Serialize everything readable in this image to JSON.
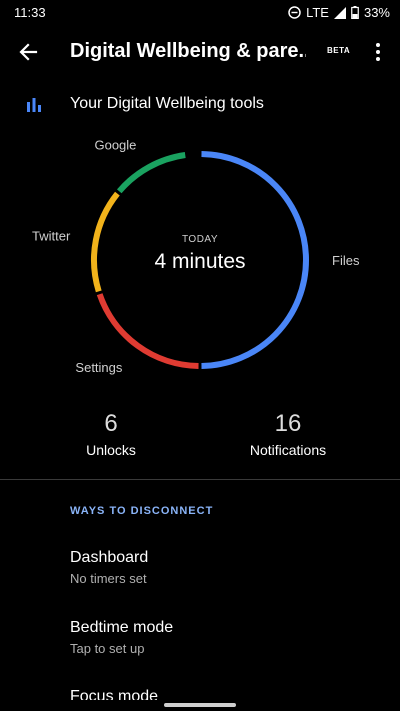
{
  "status_bar": {
    "time": "11:33",
    "network": "LTE",
    "battery": "33%"
  },
  "app_bar": {
    "title": "Digital Wellbeing & pare...",
    "badge": "BETA"
  },
  "header": {
    "title": "Your Digital Wellbeing tools"
  },
  "colors": {
    "accent_blue": "#4a86f7",
    "red": "#df3b32",
    "yellow": "#f2b31b",
    "green": "#1aa260",
    "section_label": "#8ab4f8"
  },
  "chart_data": {
    "type": "pie",
    "center_label": "TODAY",
    "center_value": "4 minutes",
    "slices": [
      {
        "label": "Files",
        "fraction": 0.5,
        "color": "#4a86f7"
      },
      {
        "label": "Settings",
        "fraction": 0.2,
        "color": "#df3b32"
      },
      {
        "label": "Twitter",
        "fraction": 0.16,
        "color": "#f2b31b"
      },
      {
        "label": "Google",
        "fraction": 0.12,
        "color": "#1aa260"
      }
    ]
  },
  "summary": {
    "unlocks": {
      "value": "6",
      "label": "Unlocks"
    },
    "notifications": {
      "value": "16",
      "label": "Notifications"
    }
  },
  "ways": {
    "label": "WAYS TO DISCONNECT",
    "items": [
      {
        "title": "Dashboard",
        "subtitle": "No timers set"
      },
      {
        "title": "Bedtime mode",
        "subtitle": "Tap to set up"
      },
      {
        "title": "Focus mode"
      }
    ]
  }
}
